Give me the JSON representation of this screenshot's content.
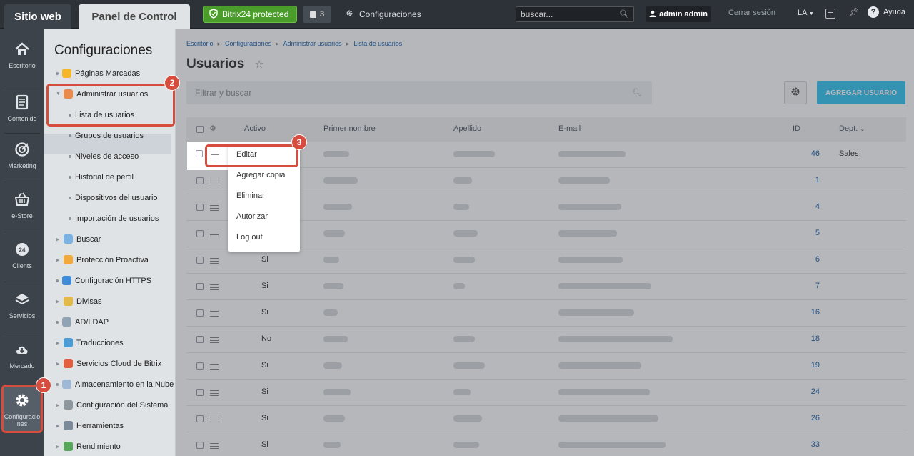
{
  "topbar": {
    "site_tab": "Sitio web",
    "panel_tab": "Panel de Control",
    "protected": "Bitrix24 protected",
    "notif_count": "3",
    "config": "Configuraciones",
    "search_placeholder": "buscar...",
    "user": "admin admin",
    "logout": "Cerrar sesión",
    "lang": "LA",
    "help": "Ayuda"
  },
  "leftnav": [
    {
      "label": "Escritorio",
      "icon": "home-icon"
    },
    {
      "label": "Contenido",
      "icon": "document-icon"
    },
    {
      "label": "Marketing",
      "icon": "target-icon"
    },
    {
      "label": "e-Store",
      "icon": "basket-icon"
    },
    {
      "label": "Clients",
      "icon": "clock-24-icon"
    },
    {
      "label": "Servicios",
      "icon": "layers-icon"
    },
    {
      "label": "Mercado",
      "icon": "cloud-download-icon"
    },
    {
      "label": "Configuraciones",
      "icon": "gear-icon"
    }
  ],
  "submenu": {
    "title": "Configuraciones",
    "items": [
      {
        "label": "Páginas Marcadas",
        "icon": "star-icon",
        "level": 0
      },
      {
        "label": "Administrar usuarios",
        "icon": "user-icon",
        "level": 0
      },
      {
        "label": "Lista de usuarios",
        "level": 1
      },
      {
        "label": "Grupos de usuarios",
        "level": 1
      },
      {
        "label": "Niveles de acceso",
        "level": 1
      },
      {
        "label": "Historial de perfil",
        "level": 1
      },
      {
        "label": "Dispositivos del usuario",
        "level": 1
      },
      {
        "label": "Importación de usuarios",
        "level": 1
      },
      {
        "label": "Buscar",
        "icon": "search-icon",
        "level": 0
      },
      {
        "label": "Protección Proactiva",
        "icon": "lock-icon",
        "level": 0
      },
      {
        "label": "Configuración HTTPS",
        "icon": "https-lock-icon",
        "level": 0
      },
      {
        "label": "Divisas",
        "icon": "currency-icon",
        "level": 0
      },
      {
        "label": "AD/LDAP",
        "icon": "ldap-icon",
        "level": 0
      },
      {
        "label": "Traducciones",
        "icon": "globe-icon",
        "level": 0
      },
      {
        "label": "Servicios Cloud de Bitrix",
        "icon": "cloud-service-icon",
        "level": 0
      },
      {
        "label": "Almacenamiento en la Nube",
        "icon": "cloud-storage-icon",
        "level": 0
      },
      {
        "label": "Configuración del Sistema",
        "icon": "gear-small-icon",
        "level": 0
      },
      {
        "label": "Herramientas",
        "icon": "tools-icon",
        "level": 0
      },
      {
        "label": "Rendimiento",
        "icon": "performance-icon",
        "level": 0
      }
    ]
  },
  "breadcrumbs": [
    "Escritorio",
    "Configuraciones",
    "Administrar usuarios",
    "Lista de usuarios"
  ],
  "page_title": "Usuarios",
  "filter_placeholder": "Filtrar y buscar",
  "add_button": "AGREGAR USUARIO",
  "columns": {
    "active": "Activo",
    "first_name": "Primer nombre",
    "last_name": "Apellido",
    "email": "E-mail",
    "id": "ID",
    "dept": "Dept."
  },
  "rows": [
    {
      "active": "",
      "id": "46",
      "dept": "Sales"
    },
    {
      "active": "",
      "id": "1",
      "dept": ""
    },
    {
      "active": "",
      "id": "4",
      "dept": ""
    },
    {
      "active": "",
      "id": "5",
      "dept": ""
    },
    {
      "active": "Si",
      "id": "6",
      "dept": ""
    },
    {
      "active": "Si",
      "id": "7",
      "dept": ""
    },
    {
      "active": "Si",
      "id": "16",
      "dept": ""
    },
    {
      "active": "No",
      "id": "18",
      "dept": ""
    },
    {
      "active": "Si",
      "id": "19",
      "dept": ""
    },
    {
      "active": "Si",
      "id": "24",
      "dept": ""
    },
    {
      "active": "Si",
      "id": "26",
      "dept": ""
    },
    {
      "active": "Si",
      "id": "33",
      "dept": ""
    }
  ],
  "context_menu": [
    "Editar",
    "Agregar copia",
    "Eliminar",
    "Autorizar",
    "Log out"
  ],
  "badges": [
    "1",
    "2",
    "3"
  ],
  "colors": {
    "accent": "#3bc8f5",
    "highlight": "#d64c3e",
    "protected": "#4b9d2b",
    "link": "#2067b0"
  }
}
